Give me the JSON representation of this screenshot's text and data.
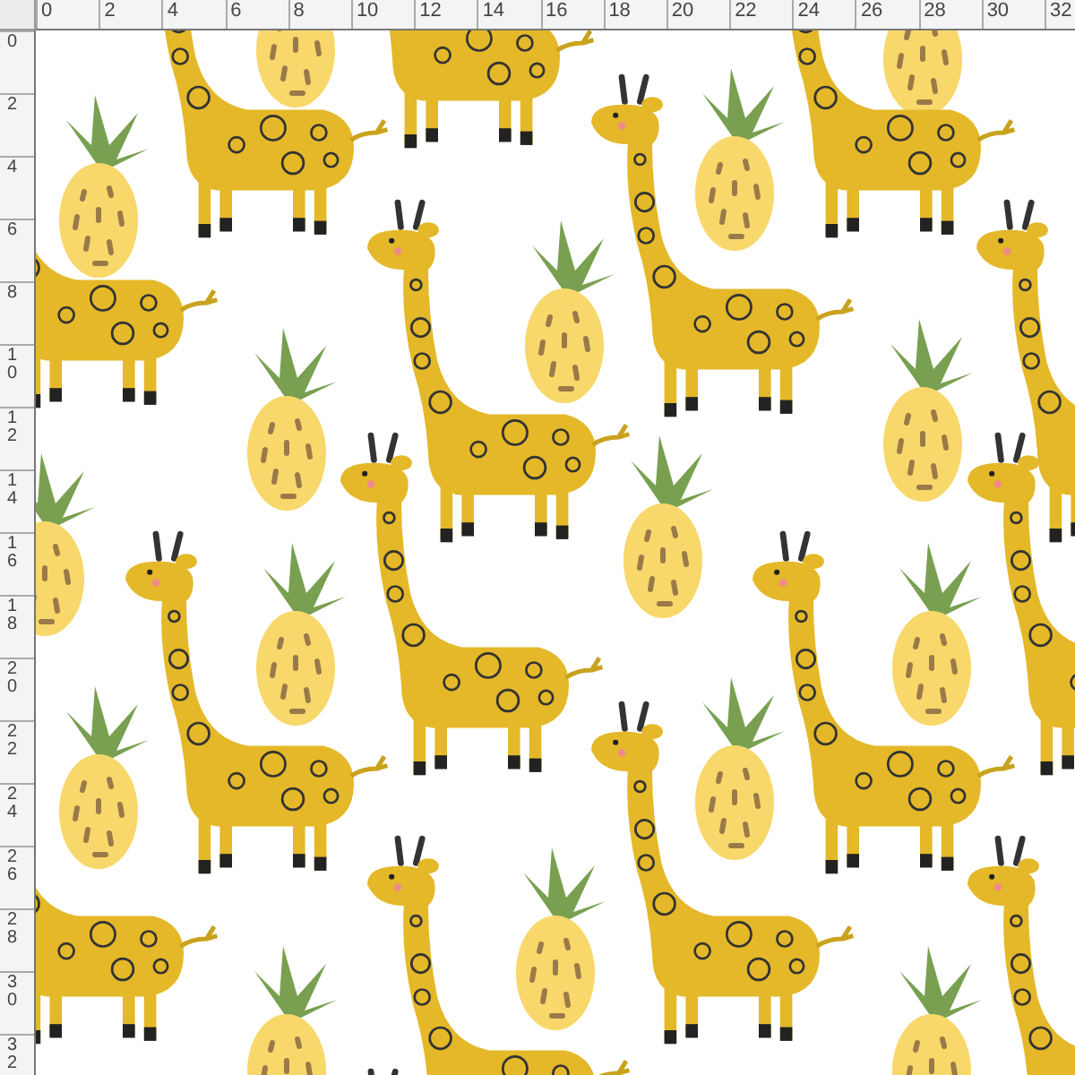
{
  "horizontal_ruler": {
    "labels": [
      "0",
      "2",
      "4",
      "6",
      "8",
      "10",
      "12",
      "14",
      "16",
      "18",
      "20",
      "22",
      "24",
      "26",
      "28",
      "30",
      "32"
    ]
  },
  "vertical_ruler": {
    "labels": [
      "0",
      "2",
      "4",
      "6",
      "8",
      "10",
      "12",
      "14",
      "16",
      "18",
      "20",
      "22",
      "24",
      "26",
      "28",
      "30",
      "32"
    ]
  }
}
